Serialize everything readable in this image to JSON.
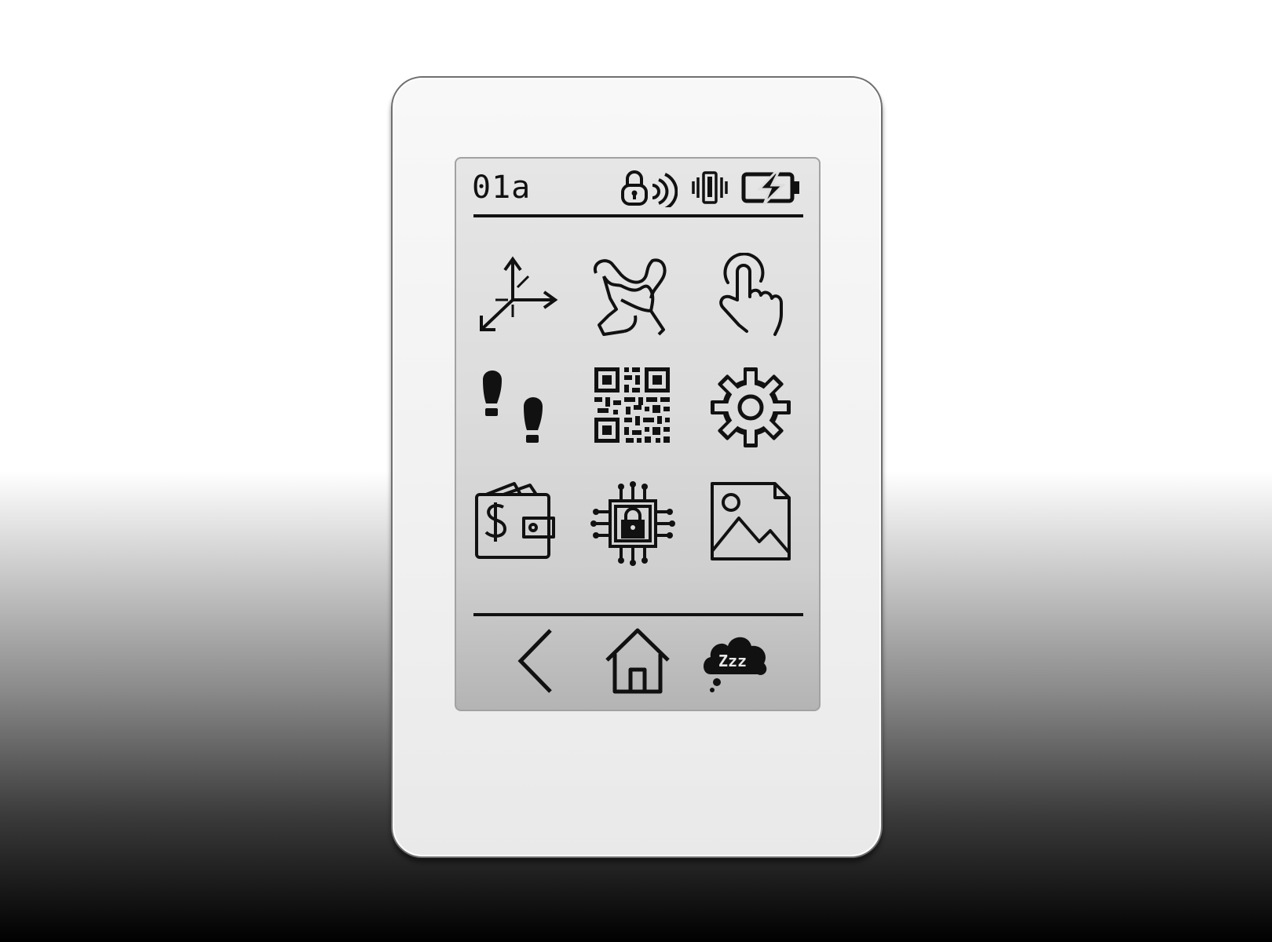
{
  "status_bar": {
    "device_id": "01a",
    "icons": [
      "nfc-lock-icon",
      "vibrate-icon",
      "battery-charging-icon"
    ]
  },
  "app_grid": [
    {
      "name": "axes-icon"
    },
    {
      "name": "path-trace-icon"
    },
    {
      "name": "touch-gesture-icon"
    },
    {
      "name": "footsteps-icon"
    },
    {
      "name": "qr-code-icon"
    },
    {
      "name": "settings-gear-icon"
    },
    {
      "name": "wallet-icon"
    },
    {
      "name": "secure-chip-icon"
    },
    {
      "name": "image-icon"
    }
  ],
  "nav_bar": {
    "icons": [
      "back-icon",
      "home-icon",
      "sleep-icon"
    ],
    "sleep_badge": "Zzz"
  },
  "colors": {
    "ink": "#111111",
    "screen": "#dcdcdc",
    "bezel": "#f3f3f3"
  }
}
